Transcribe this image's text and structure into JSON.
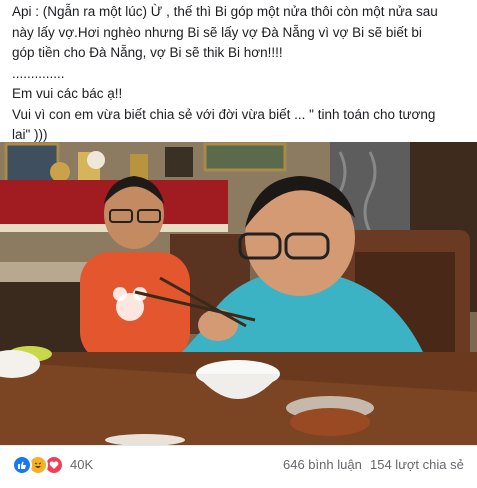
{
  "post": {
    "lines": [
      "Api : (Ngẫn ra một lúc) Ừ , thế thì Bi góp một nửa thôi còn một nửa sau",
      "này lấy vợ.Hơi nghèo nhưng Bi sẽ lấy vợ Đà Nẵng vì vợ Bi sẽ biết bi",
      "góp tiền cho Đà Nẵng, vợ Bi sẽ thik Bi hơn!!!!",
      "..............",
      "Em vui các bác ạ!!",
      "Vui vì con em vừa biết chia sẻ với đời vừa biết ... \" tinh toán cho tương",
      "lai\" )))"
    ]
  },
  "reactions": {
    "icons": [
      "like-icon",
      "haha-icon",
      "love-icon"
    ],
    "count": "40K",
    "comments": "646 bình luận",
    "shares": "154 lượt chia sẻ"
  },
  "colors": {
    "like": "#1877f2",
    "haha": "#f7b125",
    "love": "#f33e58",
    "meta_text": "#65676b"
  }
}
